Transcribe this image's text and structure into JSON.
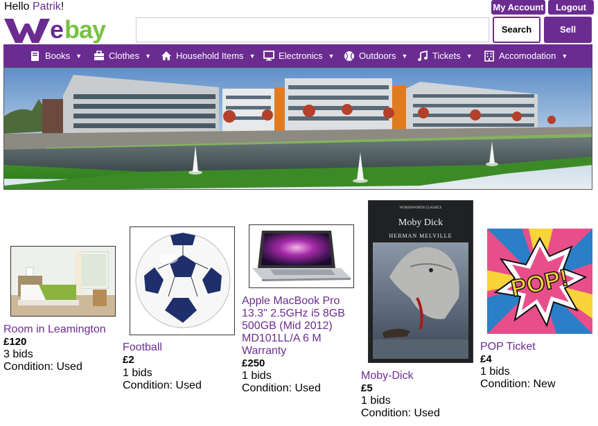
{
  "header": {
    "greeting_prefix": "Hello ",
    "user_name": "Patrik",
    "greeting_suffix": "!",
    "my_account_label": "My Account",
    "logout_label": "Logout",
    "logo_text": "Webay",
    "search_placeholder": "",
    "search_value": "",
    "search_label": "Search",
    "sell_label": "Sell"
  },
  "nav": {
    "items": [
      {
        "label": "Books",
        "icon": "book-icon"
      },
      {
        "label": "Clothes",
        "icon": "briefcase-icon"
      },
      {
        "label": "Household Items",
        "icon": "home-icon"
      },
      {
        "label": "Electronics",
        "icon": "monitor-icon"
      },
      {
        "label": "Outdoors",
        "icon": "ball-icon"
      },
      {
        "label": "Tickets",
        "icon": "music-icon"
      },
      {
        "label": "Accomodation",
        "icon": "building-icon"
      }
    ]
  },
  "listings": [
    {
      "title": "Room in Leamington",
      "price": "£120",
      "bids": "3 bids",
      "condition": "Condition: Used"
    },
    {
      "title": "Football",
      "price": "£2",
      "bids": "1 bids",
      "condition": "Condition: Used"
    },
    {
      "title_lines": [
        "Apple MacBook Pro",
        "13.3\" 2.5GHz i5 8GB",
        "500GB (Mid 2012)",
        "MD101LL/A 6 M",
        "Warranty"
      ],
      "price": "£250",
      "bids": "1 bids",
      "condition": "Condition: Used"
    },
    {
      "title": "Moby-Dick",
      "price": "£5",
      "bids": "1 bids",
      "condition": "Condition: Used",
      "cover_header": "WORDSWORTH CLASSICS",
      "cover_title": "Moby Dick",
      "cover_author": "HERMAN MELVILLE"
    },
    {
      "title": "POP Ticket",
      "price": "£4",
      "bids": "1 bids",
      "condition": "Condition: New",
      "pop_text": "POP!"
    }
  ],
  "colors": {
    "brand_purple": "#6b2c91",
    "logo_green": "#7ac143"
  }
}
